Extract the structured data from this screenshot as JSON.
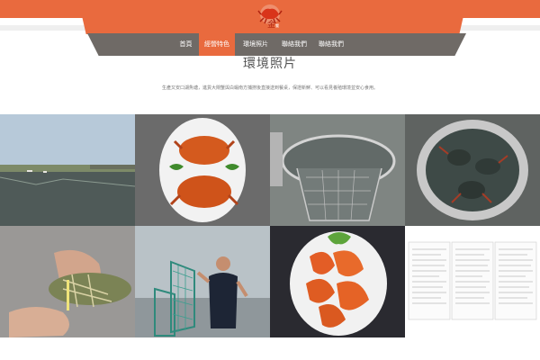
{
  "header": {
    "logo": "crab-logo",
    "brand_color": "#e96a3e",
    "nav_color": "#6f6a66"
  },
  "nav": {
    "items": [
      {
        "label": "首頁",
        "active": false
      },
      {
        "label": "經營特色",
        "active": true
      },
      {
        "label": "環境照片",
        "active": false
      },
      {
        "label": "聯絡我們",
        "active": false
      },
      {
        "label": "聯絡我們",
        "active": false
      }
    ]
  },
  "main": {
    "title": "環境照片",
    "intro": "生產又安口湖魚塘，進貨大閘蟹與白蝦南方捕撈後直接送到餐桌，保證新鮮、可以看見養殖環境並安心食用。"
  },
  "gallery": [
    {
      "name": "fish-pond-photo"
    },
    {
      "name": "steamed-crab-dish-photo"
    },
    {
      "name": "crab-trap-basket-photo"
    },
    {
      "name": "crabs-in-basin-photo"
    },
    {
      "name": "tied-crab-hands-photo"
    },
    {
      "name": "man-with-crab-nets-photo"
    },
    {
      "name": "grilled-shrimp-plate-photo"
    },
    {
      "name": "inspection-reports-photo"
    }
  ]
}
